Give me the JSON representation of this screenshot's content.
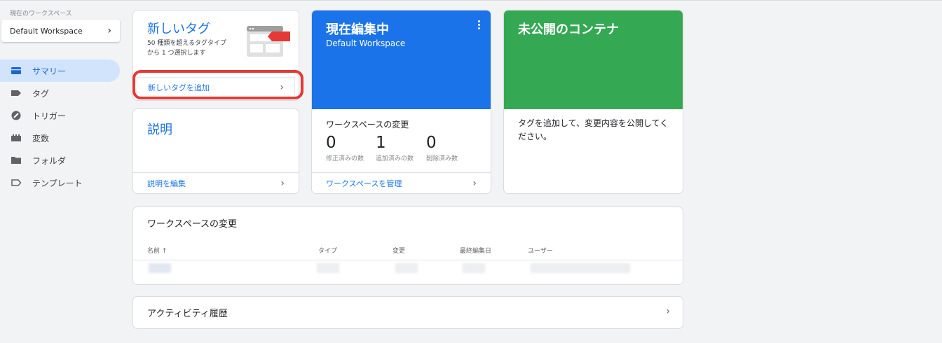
{
  "sidebar": {
    "workspace_label": "現在のワークスペース",
    "workspace_name": "Default Workspace",
    "items": [
      {
        "label": "サマリー",
        "icon": "summary-icon",
        "active": true
      },
      {
        "label": "タグ",
        "icon": "tag-icon"
      },
      {
        "label": "トリガー",
        "icon": "trigger-icon"
      },
      {
        "label": "変数",
        "icon": "variable-icon"
      },
      {
        "label": "フォルダ",
        "icon": "folder-icon"
      },
      {
        "label": "テンプレート",
        "icon": "template-icon"
      }
    ]
  },
  "new_tag": {
    "title": "新しいタグ",
    "description": "50 種類を超えるタグタイプから 1 つ選択します",
    "link": "新しいタグを追加"
  },
  "description_card": {
    "title": "説明",
    "link": "説明を編集"
  },
  "editing": {
    "title": "現在編集中",
    "workspace": "Default Workspace",
    "section_title": "ワークスペースの変更",
    "stats": [
      {
        "value": "0",
        "label": "修正済みの数"
      },
      {
        "value": "1",
        "label": "追加済みの数"
      },
      {
        "value": "0",
        "label": "削除済み数"
      }
    ],
    "link": "ワークスペースを管理"
  },
  "unpublished": {
    "title": "未公開のコンテナ",
    "body": "タグを追加して、変更内容を公開してください。"
  },
  "changes_table": {
    "title": "ワークスペースの変更",
    "columns": [
      "名前 ↑",
      "タイプ",
      "変更",
      "最終編集日",
      "ユーザー"
    ]
  },
  "activity": {
    "title": "アクティビティ履歴"
  },
  "colors": {
    "accent": "#1a73e8",
    "editing_header": "#1a73e8",
    "unpublished_header": "#34a853",
    "highlight": "#e53935",
    "nav_active_bg": "#d2e3fc"
  }
}
